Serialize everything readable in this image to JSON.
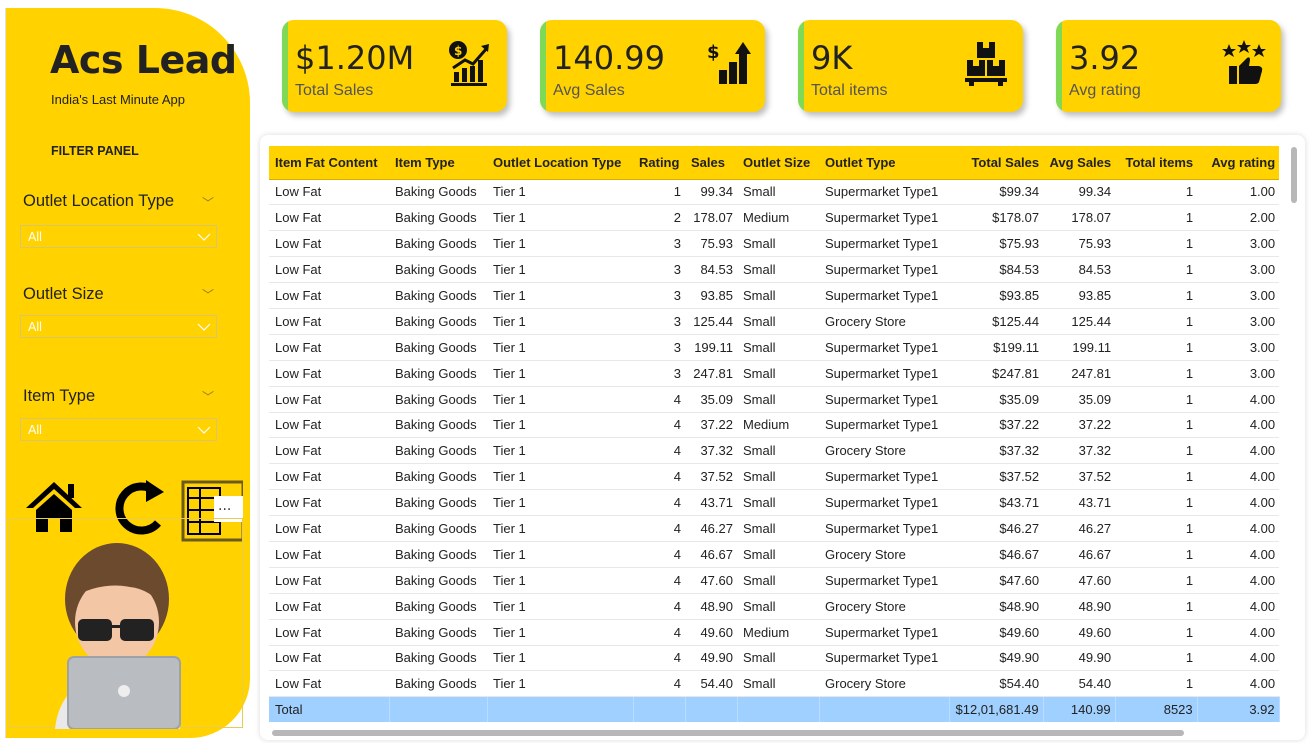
{
  "app": {
    "title": "Acs Lead",
    "subtitle": "India's Last Minute App",
    "filter_panel_title": "FILTER PANEL"
  },
  "filters": [
    {
      "label": "Outlet Location Type",
      "value": "All"
    },
    {
      "label": "Outlet Size",
      "value": "All"
    },
    {
      "label": "Item Type",
      "value": "All"
    }
  ],
  "nav": {
    "home_icon": "home-icon",
    "reset_icon": "refresh-icon",
    "table_icon": "table-icon",
    "more_glyph": "···"
  },
  "kpis": [
    {
      "value": "$1.20M",
      "label": "Total Sales",
      "icon": "sales-chart-icon"
    },
    {
      "value": "140.99",
      "label": "Avg Sales",
      "icon": "dollar-growth-icon"
    },
    {
      "value": "9K",
      "label": "Total items",
      "icon": "boxes-icon"
    },
    {
      "value": "3.92",
      "label": "Avg rating",
      "icon": "thumbs-up-stars-icon"
    }
  ],
  "table": {
    "columns": [
      "Item Fat Content",
      "Item Type",
      "Outlet Location Type",
      "Rating",
      "Sales",
      "Outlet Size",
      "Outlet Type",
      "Total Sales",
      "Avg Sales",
      "Total items",
      "Avg rating"
    ],
    "rows": [
      [
        "Low Fat",
        "Baking Goods",
        "Tier 1",
        "1",
        "99.34",
        "Small",
        "Supermarket Type1",
        "$99.34",
        "99.34",
        "1",
        "1.00"
      ],
      [
        "Low Fat",
        "Baking Goods",
        "Tier 1",
        "2",
        "178.07",
        "Medium",
        "Supermarket Type1",
        "$178.07",
        "178.07",
        "1",
        "2.00"
      ],
      [
        "Low Fat",
        "Baking Goods",
        "Tier 1",
        "3",
        "75.93",
        "Small",
        "Supermarket Type1",
        "$75.93",
        "75.93",
        "1",
        "3.00"
      ],
      [
        "Low Fat",
        "Baking Goods",
        "Tier 1",
        "3",
        "84.53",
        "Small",
        "Supermarket Type1",
        "$84.53",
        "84.53",
        "1",
        "3.00"
      ],
      [
        "Low Fat",
        "Baking Goods",
        "Tier 1",
        "3",
        "93.85",
        "Small",
        "Supermarket Type1",
        "$93.85",
        "93.85",
        "1",
        "3.00"
      ],
      [
        "Low Fat",
        "Baking Goods",
        "Tier 1",
        "3",
        "125.44",
        "Small",
        "Grocery Store",
        "$125.44",
        "125.44",
        "1",
        "3.00"
      ],
      [
        "Low Fat",
        "Baking Goods",
        "Tier 1",
        "3",
        "199.11",
        "Small",
        "Supermarket Type1",
        "$199.11",
        "199.11",
        "1",
        "3.00"
      ],
      [
        "Low Fat",
        "Baking Goods",
        "Tier 1",
        "3",
        "247.81",
        "Small",
        "Supermarket Type1",
        "$247.81",
        "247.81",
        "1",
        "3.00"
      ],
      [
        "Low Fat",
        "Baking Goods",
        "Tier 1",
        "4",
        "35.09",
        "Small",
        "Supermarket Type1",
        "$35.09",
        "35.09",
        "1",
        "4.00"
      ],
      [
        "Low Fat",
        "Baking Goods",
        "Tier 1",
        "4",
        "37.22",
        "Medium",
        "Supermarket Type1",
        "$37.22",
        "37.22",
        "1",
        "4.00"
      ],
      [
        "Low Fat",
        "Baking Goods",
        "Tier 1",
        "4",
        "37.32",
        "Small",
        "Grocery Store",
        "$37.32",
        "37.32",
        "1",
        "4.00"
      ],
      [
        "Low Fat",
        "Baking Goods",
        "Tier 1",
        "4",
        "37.52",
        "Small",
        "Supermarket Type1",
        "$37.52",
        "37.52",
        "1",
        "4.00"
      ],
      [
        "Low Fat",
        "Baking Goods",
        "Tier 1",
        "4",
        "43.71",
        "Small",
        "Supermarket Type1",
        "$43.71",
        "43.71",
        "1",
        "4.00"
      ],
      [
        "Low Fat",
        "Baking Goods",
        "Tier 1",
        "4",
        "46.27",
        "Small",
        "Supermarket Type1",
        "$46.27",
        "46.27",
        "1",
        "4.00"
      ],
      [
        "Low Fat",
        "Baking Goods",
        "Tier 1",
        "4",
        "46.67",
        "Small",
        "Grocery Store",
        "$46.67",
        "46.67",
        "1",
        "4.00"
      ],
      [
        "Low Fat",
        "Baking Goods",
        "Tier 1",
        "4",
        "47.60",
        "Small",
        "Supermarket Type1",
        "$47.60",
        "47.60",
        "1",
        "4.00"
      ],
      [
        "Low Fat",
        "Baking Goods",
        "Tier 1",
        "4",
        "48.90",
        "Small",
        "Grocery Store",
        "$48.90",
        "48.90",
        "1",
        "4.00"
      ],
      [
        "Low Fat",
        "Baking Goods",
        "Tier 1",
        "4",
        "49.60",
        "Medium",
        "Supermarket Type1",
        "$49.60",
        "49.60",
        "1",
        "4.00"
      ],
      [
        "Low Fat",
        "Baking Goods",
        "Tier 1",
        "4",
        "49.90",
        "Small",
        "Supermarket Type1",
        "$49.90",
        "49.90",
        "1",
        "4.00"
      ],
      [
        "Low Fat",
        "Baking Goods",
        "Tier 1",
        "4",
        "54.40",
        "Small",
        "Grocery Store",
        "$54.40",
        "54.40",
        "1",
        "4.00"
      ]
    ],
    "total": {
      "label": "Total",
      "total_sales": "$12,01,681.49",
      "avg_sales": "140.99",
      "total_items": "8523",
      "avg_rating": "3.92"
    },
    "right_aligned": [
      3,
      4,
      7,
      8,
      9,
      10
    ]
  },
  "colors": {
    "accent": "#FFD200",
    "kpi_stripe": "#7ed957",
    "total_row": "#9FD0FF"
  }
}
